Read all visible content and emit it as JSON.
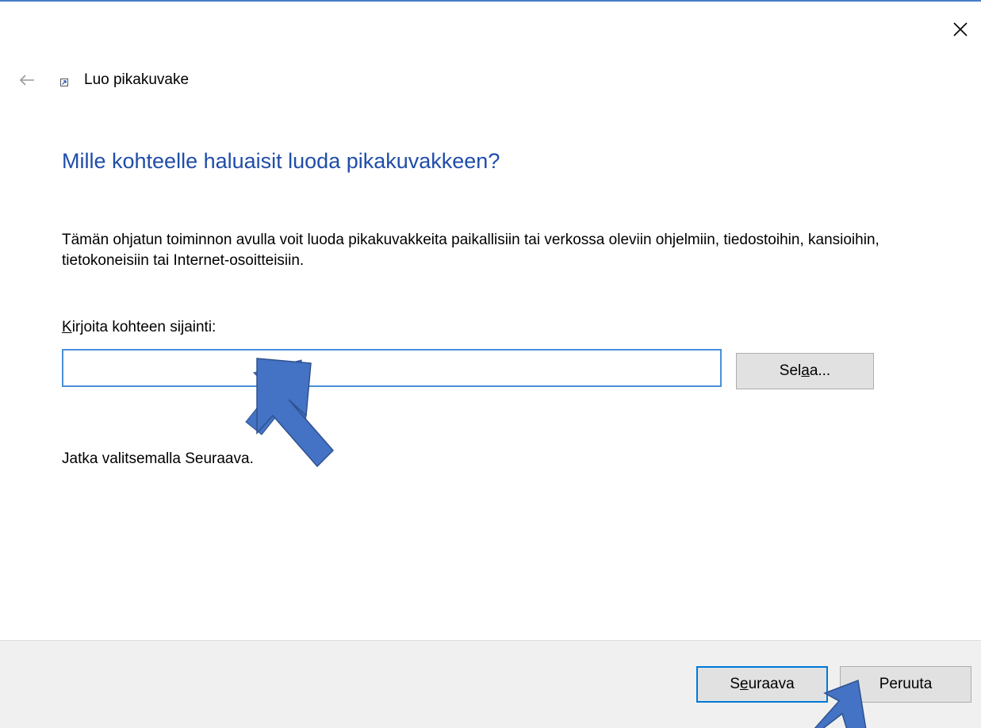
{
  "wizard": {
    "title": "Luo pikakuvake",
    "heading": "Mille kohteelle haluaisit luoda pikakuvakkeen?",
    "description": "Tämän ohjatun toiminnon avulla voit luoda pikakuvakkeita paikallisiin tai verkossa oleviin ohjelmiin, tiedostoihin, kansioihin, tietokoneisiin tai Internet-osoitteisiin.",
    "location_label_access_key": "K",
    "location_label_rest": "irjoita kohteen sijainti:",
    "location_value": "",
    "browse_pre": "Sel",
    "browse_key": "a",
    "browse_post": "a...",
    "continue_text": "Jatka valitsemalla Seuraava."
  },
  "footer": {
    "next_pre": "S",
    "next_key": "e",
    "next_post": "uraava",
    "cancel_label": "Peruuta"
  },
  "icons": {
    "close": "close-icon",
    "back": "back-arrow-icon",
    "shortcut": "shortcut-icon"
  },
  "colors": {
    "heading": "#1f4da8",
    "annotation_arrow": "#4472c4",
    "input_border": "#4a90d9",
    "footer_bg": "#f0f0f0"
  }
}
